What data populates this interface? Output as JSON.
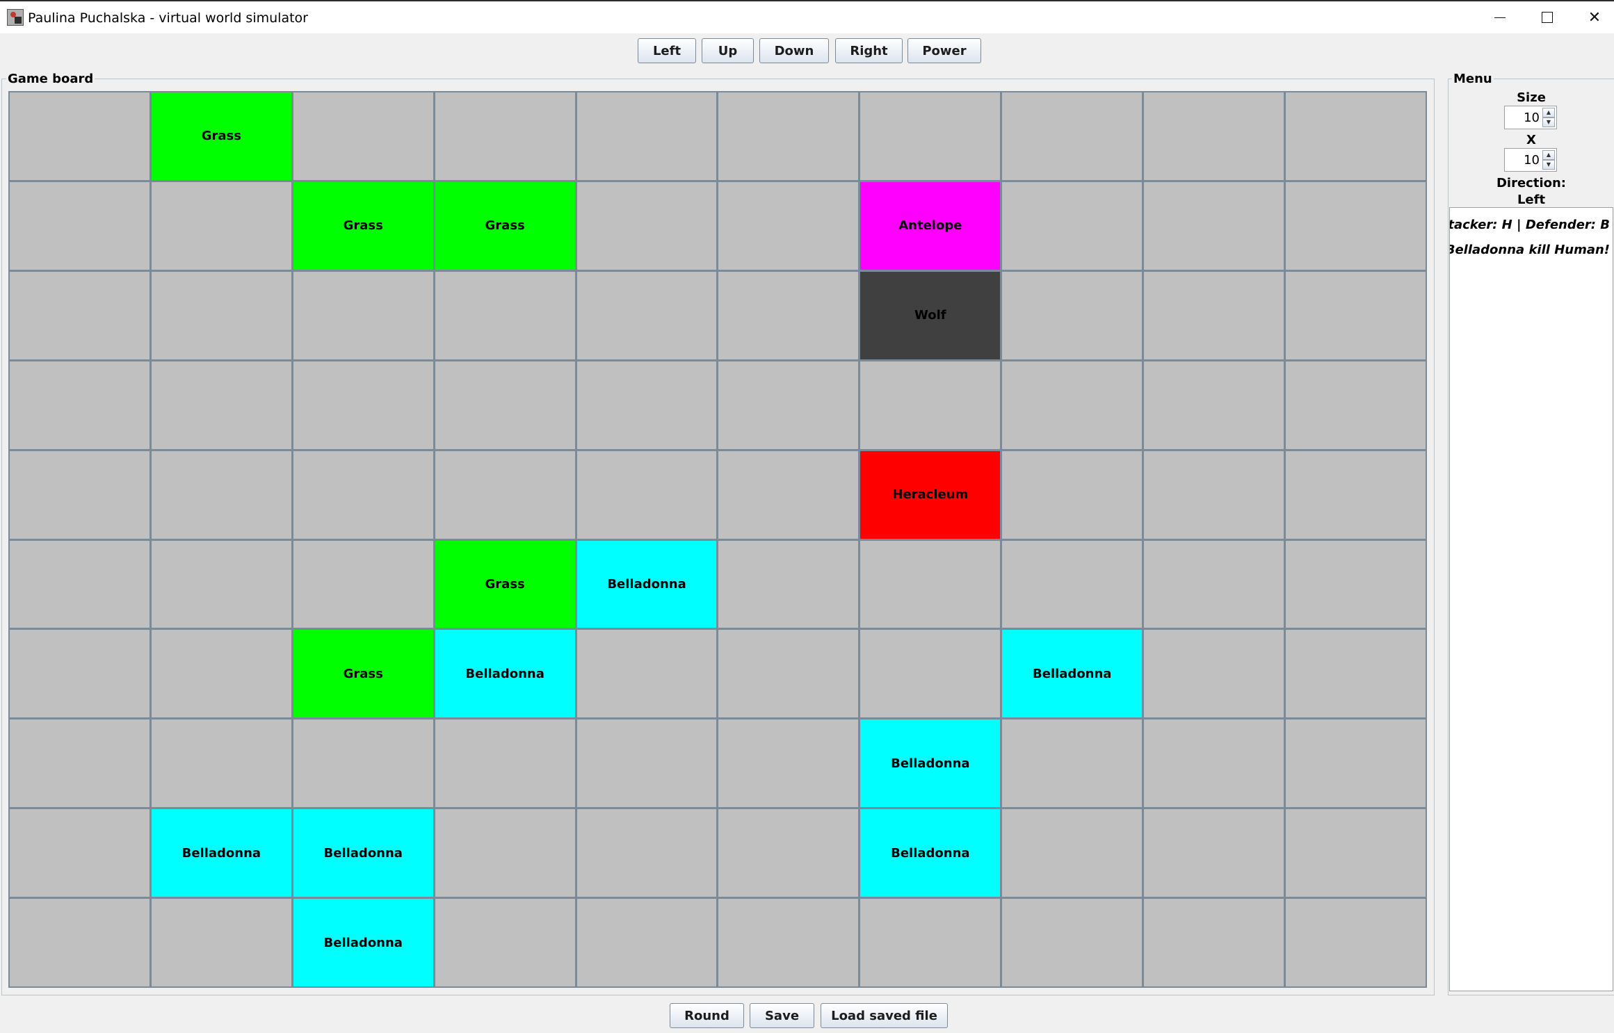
{
  "window": {
    "title": "Paulina Puchalska - virtual world simulator",
    "minimize_icon": "minimize-icon",
    "maximize_icon": "maximize-icon",
    "close_icon": "close-icon",
    "close_glyph": "✕"
  },
  "controls": {
    "left": "Left",
    "up": "Up",
    "down": "Down",
    "right": "Right",
    "power": "Power"
  },
  "board": {
    "label": "Game board",
    "rows": 10,
    "cols": 10,
    "colors": {
      "empty": "#c0c0c0",
      "Grass": "#00ff00",
      "Antelope": "#ff00ff",
      "Wolf": "#404040",
      "Heracleum": "#ff0000",
      "Belladonna": "#00ffff",
      "grid": "#7a8a99"
    },
    "organisms": [
      {
        "row": 0,
        "col": 1,
        "name": "Grass"
      },
      {
        "row": 1,
        "col": 2,
        "name": "Grass"
      },
      {
        "row": 1,
        "col": 3,
        "name": "Grass"
      },
      {
        "row": 1,
        "col": 6,
        "name": "Antelope"
      },
      {
        "row": 2,
        "col": 6,
        "name": "Wolf"
      },
      {
        "row": 4,
        "col": 6,
        "name": "Heracleum"
      },
      {
        "row": 5,
        "col": 3,
        "name": "Grass"
      },
      {
        "row": 5,
        "col": 4,
        "name": "Belladonna"
      },
      {
        "row": 6,
        "col": 2,
        "name": "Grass"
      },
      {
        "row": 6,
        "col": 3,
        "name": "Belladonna"
      },
      {
        "row": 6,
        "col": 7,
        "name": "Belladonna"
      },
      {
        "row": 7,
        "col": 6,
        "name": "Belladonna"
      },
      {
        "row": 8,
        "col": 1,
        "name": "Belladonna"
      },
      {
        "row": 8,
        "col": 2,
        "name": "Belladonna"
      },
      {
        "row": 8,
        "col": 6,
        "name": "Belladonna"
      },
      {
        "row": 9,
        "col": 2,
        "name": "Belladonna"
      }
    ]
  },
  "menu": {
    "label": "Menu",
    "size_label": "Size",
    "size_width": "10",
    "x_label": "X",
    "size_height": "10",
    "direction_label": "Direction:",
    "direction_value": "Left",
    "log": [
      "Attacker: H  |  Defender: B",
      "Belladonna kill Human!"
    ]
  },
  "bottom": {
    "round": "Round",
    "save": "Save",
    "load": "Load saved file"
  }
}
